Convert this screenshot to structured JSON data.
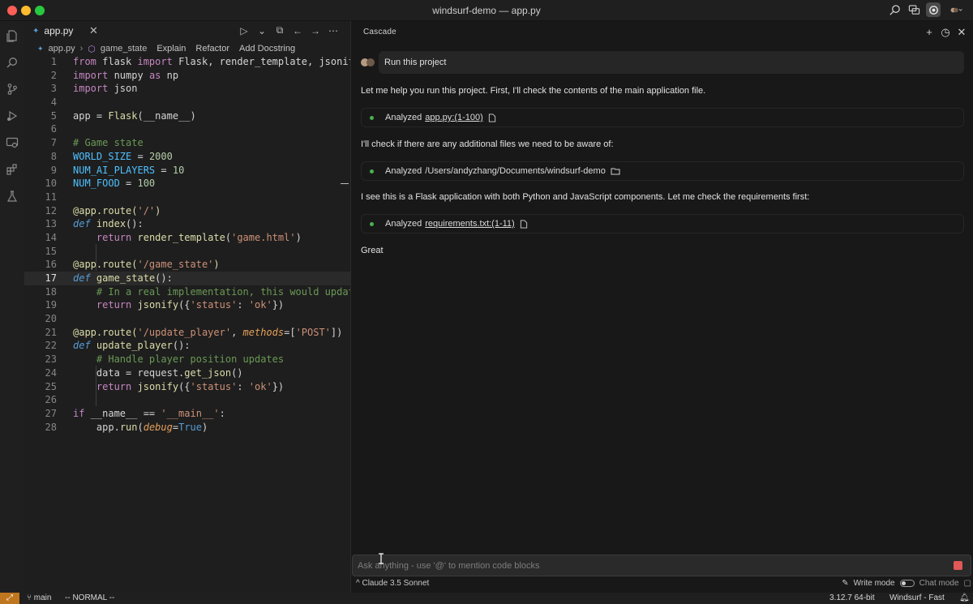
{
  "window": {
    "title": "windsurf-demo — app.py"
  },
  "editor": {
    "tab": {
      "label": "app.py",
      "close": "✕"
    },
    "tab_actions": [
      "▷",
      "⌄",
      "⧉",
      "←",
      "→",
      "⋯"
    ],
    "breadcrumb": {
      "file": "app.py",
      "symbol": "game_state",
      "lens": [
        "Explain",
        "Refactor",
        "Add Docstring"
      ]
    },
    "current_line": 17,
    "lines": [
      {
        "n": "1"
      },
      {
        "n": "2"
      },
      {
        "n": "3"
      },
      {
        "n": "4"
      },
      {
        "n": "5"
      },
      {
        "n": "6"
      },
      {
        "n": "7"
      },
      {
        "n": "8"
      },
      {
        "n": "9"
      },
      {
        "n": "10"
      },
      {
        "n": "11"
      },
      {
        "n": "12"
      },
      {
        "n": "13"
      },
      {
        "n": "14"
      },
      {
        "n": "15"
      },
      {
        "n": "16"
      },
      {
        "n": "17"
      },
      {
        "n": "18"
      },
      {
        "n": "19"
      },
      {
        "n": "20"
      },
      {
        "n": "21"
      },
      {
        "n": "22"
      },
      {
        "n": "23"
      },
      {
        "n": "24"
      },
      {
        "n": "25"
      },
      {
        "n": "26"
      },
      {
        "n": "27"
      },
      {
        "n": "28"
      }
    ],
    "code": {
      "l1": [
        "from",
        " flask ",
        "import",
        " Flask, render_template, jsonify,"
      ],
      "l2": [
        "import",
        " numpy ",
        "as",
        " np"
      ],
      "l3": [
        "import",
        " json"
      ],
      "l5": [
        "app = ",
        "Flask",
        "(__name__)"
      ],
      "l7": "# Game state",
      "l8": [
        "WORLD_SIZE",
        " = ",
        "2000"
      ],
      "l9": [
        "NUM_AI_PLAYERS",
        " = ",
        "10"
      ],
      "l10": [
        "NUM_FOOD",
        " = ",
        "100"
      ],
      "l12": [
        "@app.route(",
        "'/'",
        ")"
      ],
      "l13": [
        "def",
        " ",
        "index",
        "():"
      ],
      "l14": [
        "return",
        " ",
        "render_template",
        "(",
        "'game.html'",
        ")"
      ],
      "l16": [
        "@app.route(",
        "'/game_state'",
        ")"
      ],
      "l17": [
        "def",
        " ",
        "game_state",
        "():"
      ],
      "l18": "# In a real implementation, this would update",
      "l19": [
        "return",
        " ",
        "jsonify",
        "({",
        "'status'",
        ": ",
        "'ok'",
        "})"
      ],
      "l21": [
        "@app.route(",
        "'/update_player'",
        ", ",
        "methods",
        "=[",
        "'POST'",
        "])"
      ],
      "l22": [
        "def",
        " ",
        "update_player",
        "():"
      ],
      "l23": "# Handle player position updates",
      "l24": [
        "data = request.",
        "get_json",
        "()"
      ],
      "l25": [
        "return",
        " ",
        "jsonify",
        "({",
        "'status'",
        ": ",
        "'ok'",
        "})"
      ],
      "l27": [
        "if",
        " __name__ == ",
        "'__main__'",
        ":"
      ],
      "l28": [
        "app.",
        "run",
        "(",
        "debug",
        "=",
        "True",
        ")"
      ]
    }
  },
  "cascade": {
    "title": "Cascade",
    "user_message": "Run this project",
    "messages": [
      "Let me help you run this project. First, I'll check the contents of the main application file.",
      "I'll check if there are any additional files we need to be aware of:",
      "I see this is a Flask application with both Python and JavaScript components. Let me check the requirements first:",
      "Great"
    ],
    "steps": [
      {
        "label": "Analyzed",
        "target": "app.py:(1-100)"
      },
      {
        "label": "Analyzed",
        "target": "/Users/andyzhang/Documents/windsurf-demo"
      },
      {
        "label": "Analyzed",
        "target": "requirements.txt:(1-11)"
      }
    ],
    "input": {
      "placeholder": "Ask anything - use '@' to mention code blocks"
    },
    "model": "^ Claude 3.5 Sonnet",
    "write_mode": "Write mode",
    "chat_mode": "Chat mode"
  },
  "status": {
    "branch": "main",
    "mode": "-- NORMAL --",
    "python": "3.12.7 64-bit",
    "windsurf": "Windsurf - Fast"
  }
}
